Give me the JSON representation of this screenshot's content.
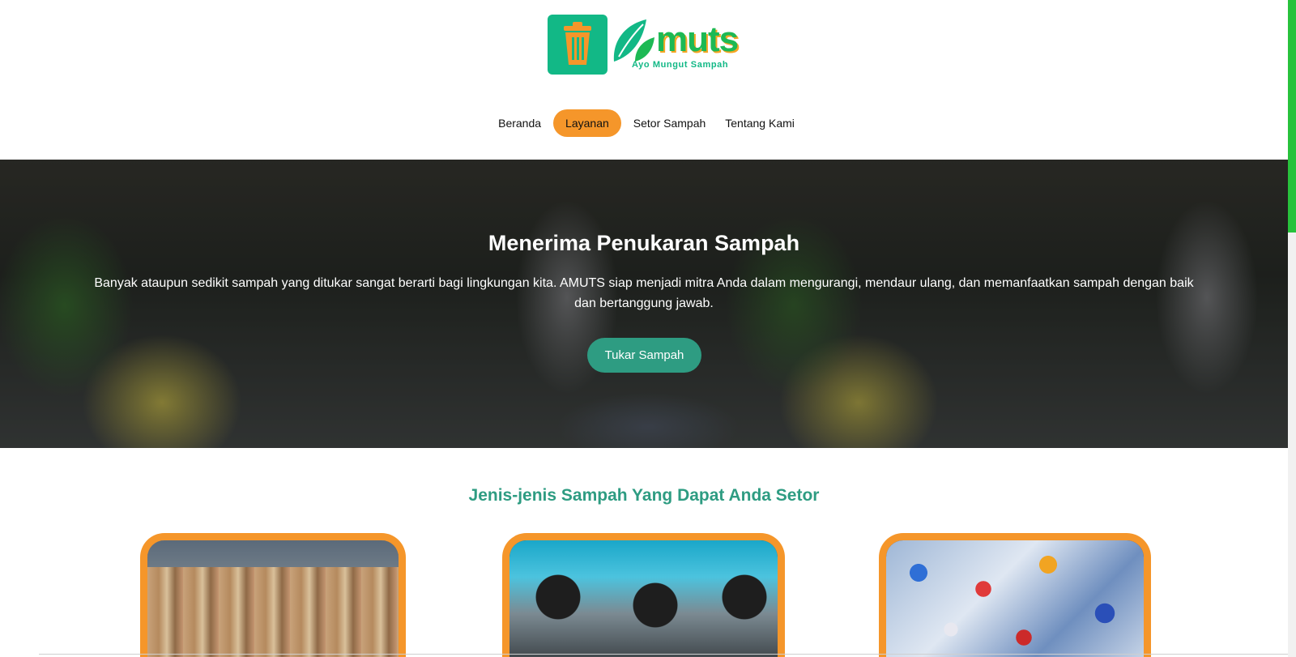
{
  "brand": {
    "name": "muts",
    "tagline": "Ayo Mungut Sampah",
    "colors": {
      "primary": "#12b886",
      "accent": "#f5962a",
      "button": "#2e9c82"
    },
    "icons": {
      "logo_box": "trash-bin-icon",
      "logo_leaf": "leaf-icon"
    }
  },
  "nav": {
    "items": [
      {
        "label": "Beranda",
        "active": false
      },
      {
        "label": "Layanan",
        "active": true
      },
      {
        "label": "Setor Sampah",
        "active": false
      },
      {
        "label": "Tentang Kami",
        "active": false
      }
    ]
  },
  "hero": {
    "title": "Menerima Penukaran Sampah",
    "description": "Banyak ataupun sedikit sampah yang ditukar sangat berarti bagi lingkungan kita. AMUTS siap menjadi mitra Anda dalam mengurangi, mendaur ulang, dan memanfaatkan sampah dengan baik dan bertanggung jawab.",
    "button_label": "Tukar Sampah"
  },
  "section": {
    "title": "Jenis-jenis Sampah Yang Dapat Anda Setor"
  }
}
